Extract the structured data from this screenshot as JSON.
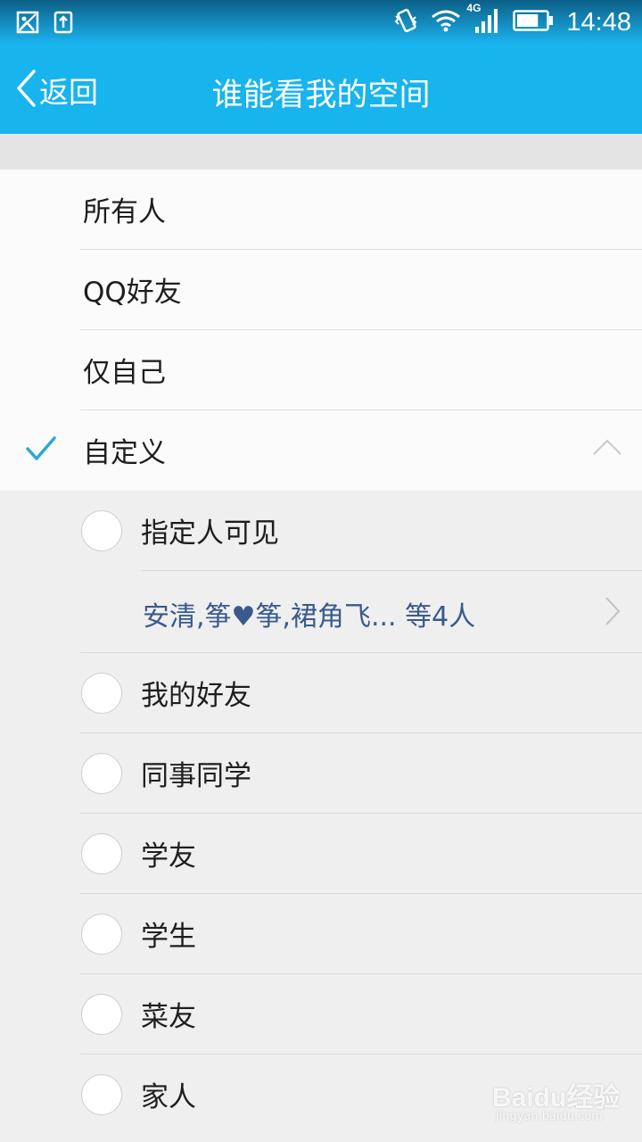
{
  "status_bar": {
    "network": "4G",
    "time": "14:48",
    "battery_level": 0.75
  },
  "nav": {
    "back_label": "返回",
    "title": "谁能看我的空间"
  },
  "options": [
    {
      "label": "所有人",
      "checked": false
    },
    {
      "label": "QQ好友",
      "checked": false
    },
    {
      "label": "仅自己",
      "checked": false
    },
    {
      "label": "自定义",
      "checked": true,
      "expanded": true
    }
  ],
  "custom": {
    "specified": {
      "label": "指定人可见",
      "selected_names": "安清,筝♥筝,裙角飞... 等4人"
    },
    "groups": [
      {
        "label": "我的好友"
      },
      {
        "label": "同事同学"
      },
      {
        "label": "学友"
      },
      {
        "label": "学生"
      },
      {
        "label": "菜友"
      },
      {
        "label": "家人"
      }
    ]
  },
  "watermark": {
    "brand": "Baidu经验",
    "url": "jingyan.baidu.com"
  },
  "colors": {
    "accent": "#18b4ee",
    "check": "#29a9d6",
    "names": "#3a5a8c"
  }
}
